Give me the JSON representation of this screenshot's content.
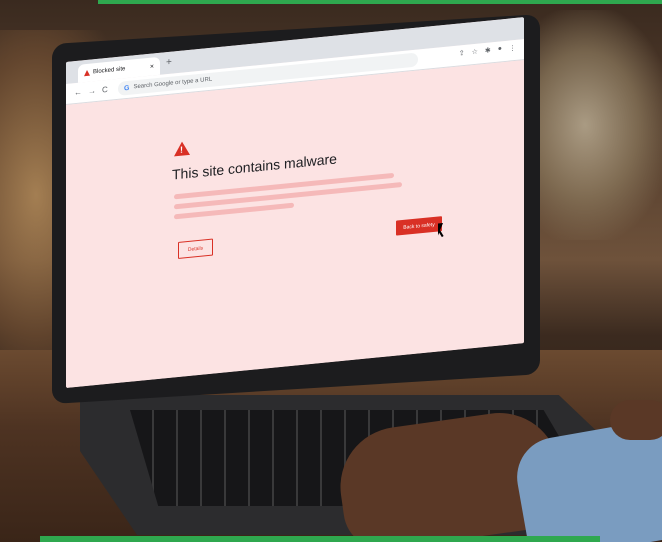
{
  "browser": {
    "tab": {
      "title": "Blocked site",
      "close": "×",
      "new_tab": "+"
    },
    "toolbar": {
      "back": "←",
      "forward": "→",
      "reload": "C",
      "google_logo": "G",
      "omnibox_placeholder": "Search Google or type a URL",
      "share_icon": "⇪",
      "star_icon": "☆",
      "extensions_icon": "✱",
      "profile_icon": "●",
      "menu_icon": "⋮"
    }
  },
  "page": {
    "warning_symbol": "!",
    "heading": "This site contains malware",
    "details_label": "Details",
    "back_to_safety_label": "Back to safety"
  },
  "colors": {
    "accent": "#d93025",
    "page_bg": "#fce3e3",
    "frame_green": "#2fa84f"
  }
}
